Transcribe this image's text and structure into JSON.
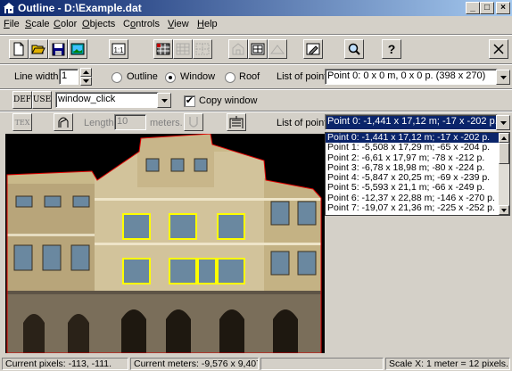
{
  "window": {
    "title": "Outline - D:\\Example.dat"
  },
  "menu": [
    "File",
    "Scale",
    "Color",
    "Objects",
    "Controls",
    "View",
    "Help"
  ],
  "menu_underline": [
    "F",
    "S",
    "C",
    "O",
    "o",
    "V",
    "H"
  ],
  "row1": {
    "line_width_label": "Line width",
    "line_width_value": "1",
    "radio_outline": "Outline",
    "radio_window": "Window",
    "radio_roof": "Roof",
    "selected_radio": "Window",
    "list_label": "List of points",
    "list_value": "Point 0: 0 x 0 m, 0 x 0 p. (398 x 270)"
  },
  "row2": {
    "def_label": "DEF",
    "use_label": "USE",
    "object_value": "window_click",
    "copy_window_label": "Copy window",
    "copy_window_checked": true
  },
  "row3": {
    "tex_label": "TEX",
    "length_label": "Length:",
    "length_value": "10",
    "meters_label": "meters.",
    "list_label": "List of points",
    "list_value": "Point 0: -1,441 x 17,12 m; -17 x -202 p."
  },
  "points": [
    "Point 0: -1,441 x 17,12 m; -17 x -202 p.",
    "Point 1: -5,508 x 17,29 m; -65 x -204 p.",
    "Point 2: -6,61 x 17,97 m; -78 x -212 p.",
    "Point 3: -6,78 x 18,98 m; -80 x -224 p.",
    "Point 4: -5,847 x 20,25 m; -69 x -239 p.",
    "Point 5: -5,593 x 21,1 m; -66 x -249 p.",
    "Point 6: -12,37 x 22,88 m; -146 x -270 p.",
    "Point 7: -19,07 x 21,36 m; -225 x -252 p."
  ],
  "selected_point_index": 0,
  "status": {
    "pixels": "Current pixels: -113, -111.",
    "meters": "Current meters: -9,576 x 9,407.",
    "scale": "Scale X: 1 meter = 12 pixels."
  },
  "colors": {
    "title_start": "#0a246a",
    "title_end": "#a6caf0",
    "outline": "#e00000",
    "window_highlight": "#ffff00",
    "selection": "#0a246a"
  },
  "icons": [
    "app-house-icon",
    "new-file-icon",
    "open-folder-icon",
    "save-icon",
    "picture-icon",
    "one-to-one-icon",
    "grid-icon",
    "grid-disabled-icon",
    "grid-dotted-icon",
    "house-disabled-icon",
    "window-icon",
    "roof-disabled-icon",
    "pen-icon",
    "magnifier-icon",
    "help-icon",
    "close-icon",
    "tex-icon",
    "arch-icon",
    "u-shape-icon",
    "stairs-icon"
  ]
}
